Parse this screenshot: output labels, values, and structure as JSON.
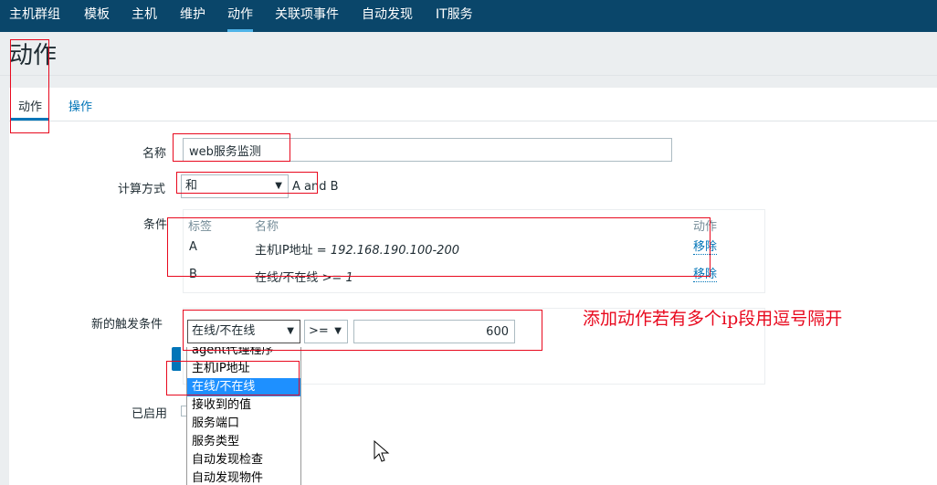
{
  "nav": {
    "items": [
      {
        "label": "主机群组"
      },
      {
        "label": "模板"
      },
      {
        "label": "主机"
      },
      {
        "label": "维护"
      },
      {
        "label": "动作",
        "active": true
      },
      {
        "label": "关联项事件"
      },
      {
        "label": "自动发现"
      },
      {
        "label": "IT服务"
      }
    ]
  },
  "page": {
    "title": "动作"
  },
  "tabs": [
    {
      "label": "动作",
      "active": true
    },
    {
      "label": "操作"
    }
  ],
  "form": {
    "name_label": "名称",
    "name_value": "web服务监测",
    "calc_label": "计算方式",
    "calc_value": "和",
    "calc_expression": "A and B",
    "conditions_label": "条件",
    "conditions": {
      "headers": {
        "label": "标签",
        "name": "名称",
        "action": "动作"
      },
      "rows": [
        {
          "label": "A",
          "name_prefix": "主机IP地址 = ",
          "name_value": "192.168.190.100-200",
          "action": "移除"
        },
        {
          "label": "B",
          "name_prefix": "在线/不在线 >= ",
          "name_value": "1",
          "action": "移除"
        }
      ]
    },
    "new_condition_label": "新的触发条件",
    "condition_type": "在线/不在线",
    "operator": ">=",
    "value": "600",
    "enabled_label": "已启用"
  },
  "dropdown": {
    "options": [
      {
        "label": "agent代理程序"
      },
      {
        "label": "主机IP地址"
      },
      {
        "label": "在线/不在线",
        "selected": true
      },
      {
        "label": "接收到的值"
      },
      {
        "label": "服务端口"
      },
      {
        "label": "服务类型"
      },
      {
        "label": "自动发现检查"
      },
      {
        "label": "自动发现物件"
      }
    ]
  },
  "annotation": {
    "text": "添加动作若有多个ip段用逗号隔开",
    "color": "#e8091e"
  },
  "colors": {
    "nav_bg": "#0a466a",
    "accent": "#0275b8",
    "highlight": "#1e90ff"
  }
}
